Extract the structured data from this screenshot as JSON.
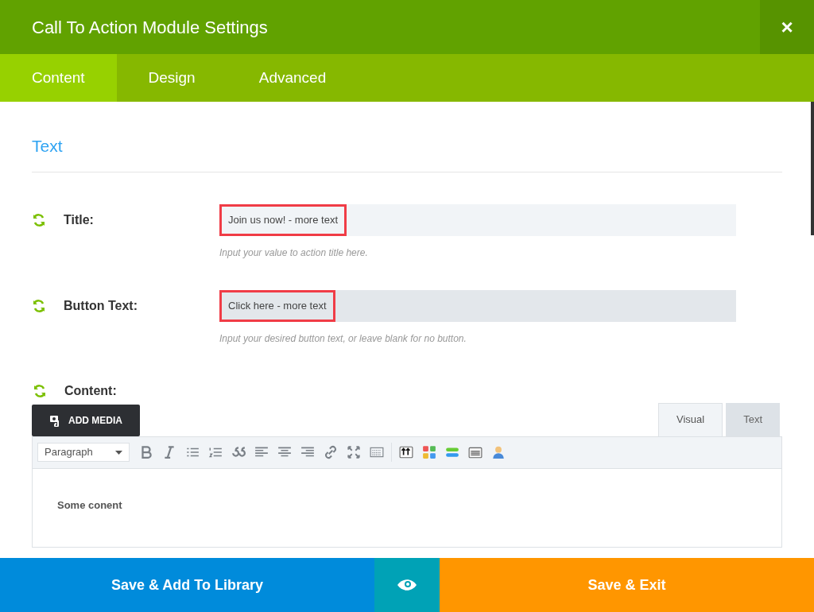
{
  "window": {
    "title": "Call To Action Module Settings",
    "close": "×"
  },
  "tabs": [
    {
      "label": "Content",
      "selected": true
    },
    {
      "label": "Design",
      "selected": false
    },
    {
      "label": "Advanced",
      "selected": false
    }
  ],
  "section": {
    "title": "Text"
  },
  "fields": [
    {
      "label": "Title:",
      "value": "Join us now! - more text",
      "hint": "Input your value to action title here.",
      "focused": false,
      "highlighted": true
    },
    {
      "label": "Button Text:",
      "value": "Click here - more text",
      "hint": "Input your desired button text, or leave blank for no button.",
      "focused": true,
      "highlighted": true
    }
  ],
  "content": {
    "label": "Content:",
    "add_media": "ADD MEDIA",
    "editor_tabs": [
      {
        "label": "Visual",
        "selected": true
      },
      {
        "label": "Text",
        "selected": false
      }
    ],
    "format": "Paragraph",
    "body": "Some conent"
  },
  "footer": {
    "save_library": "Save & Add To Library",
    "save_exit": "Save & Exit"
  }
}
